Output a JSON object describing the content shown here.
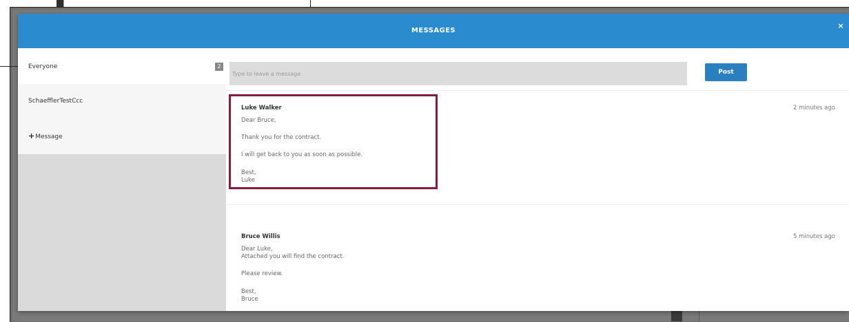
{
  "modal": {
    "title": "MESSAGES",
    "close_label": "×"
  },
  "sidebar": {
    "items": [
      {
        "label": "Everyone",
        "badge": "2"
      },
      {
        "label": "SchaefflerTestCcc"
      },
      {
        "label": "Message",
        "icon": "plus-icon"
      }
    ]
  },
  "composer": {
    "placeholder": "Type to leave a message",
    "post_label": "Post"
  },
  "messages": [
    {
      "author": "Luke Walker",
      "time": "2 minutes ago",
      "lines": [
        "Dear Bruce,",
        "Thank you for the contract.",
        "I will get back to you as soon as possible.",
        "Best,",
        "Luke"
      ]
    },
    {
      "author": "Bruce Willis",
      "time": "5 minutes ago",
      "lines": [
        "Dear Luke,",
        "Attached you will find the contract.",
        "Please review.",
        "Best,",
        "Bruce"
      ]
    }
  ],
  "colors": {
    "header": "#2a8bcf",
    "post_button": "#2a7fc1",
    "highlight": "#8b1a3a"
  }
}
